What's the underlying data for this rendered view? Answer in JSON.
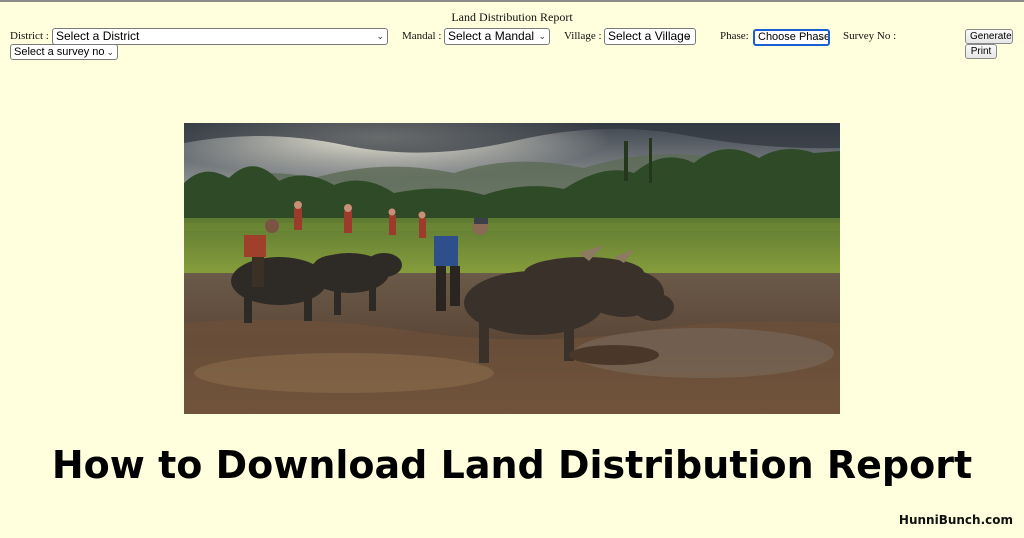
{
  "form": {
    "title": "Land Distribution Report",
    "district_label": "District :",
    "district_value": "Select a District",
    "mandal_label": "Mandal :",
    "mandal_value": "Select a Mandal",
    "village_label": "Village :",
    "village_value": "Select a Village",
    "phase_label": "Phase:",
    "phase_value": "Choose Phase",
    "survey_label": "Survey No :",
    "survey_value": "Select a survey no",
    "generate_label": "Generate",
    "print_label": "Print"
  },
  "photo": {
    "subject": "farmers ploughing a muddy paddy field with water buffalo"
  },
  "headline": "How to Download Land Distribution Report",
  "site_name": "HunniBunch.com",
  "colors": {
    "page_background": "#ffffde",
    "focus_border": "#1a5fd0",
    "headline_text": "#000000"
  }
}
